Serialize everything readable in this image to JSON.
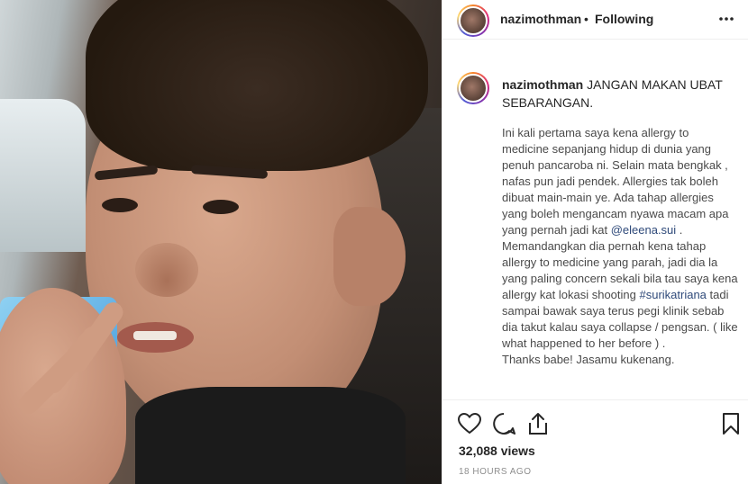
{
  "post": {
    "username": "nazimothman",
    "separator": "•",
    "follow_status": "Following",
    "more_icon": "more-horizontal-icon"
  },
  "caption": {
    "username": "nazimothman",
    "headline": "JANGAN MAKAN UBAT SEBARANGAN.",
    "text_1": "Ini kali pertama saya kena allergy to medicine sepanjang hidup di dunia yang penuh pancaroba ni. Selain mata bengkak , nafas pun jadi pendek. Allergies tak boleh dibuat main-main ye. Ada tahap allergies yang boleh mengancam nyawa macam apa yang pernah jadi kat ",
    "mention": "@eleena.sui",
    "text_2": " . Memandangkan dia pernah kena tahap allergy to medicine yang parah, jadi dia la yang paling concern sekali bila tau saya kena allergy kat lokasi shooting ",
    "hashtag": "#surikatriana",
    "text_3": " tadi sampai bawak saya terus pegi klinik sebab dia takut kalau saya collapse / pengsan. ( like what happened to her before ) .",
    "text_4": "Thanks babe! Jasamu kukenang."
  },
  "actions": {
    "like_icon": "heart-icon",
    "comment_icon": "comment-icon",
    "share_icon": "share-icon",
    "save_icon": "bookmark-icon",
    "views": "32,088 views",
    "time": "18 HOURS AGO"
  },
  "colors": {
    "link": "#2f4a7a",
    "text": "#262626",
    "muted": "#8e8e8e"
  }
}
